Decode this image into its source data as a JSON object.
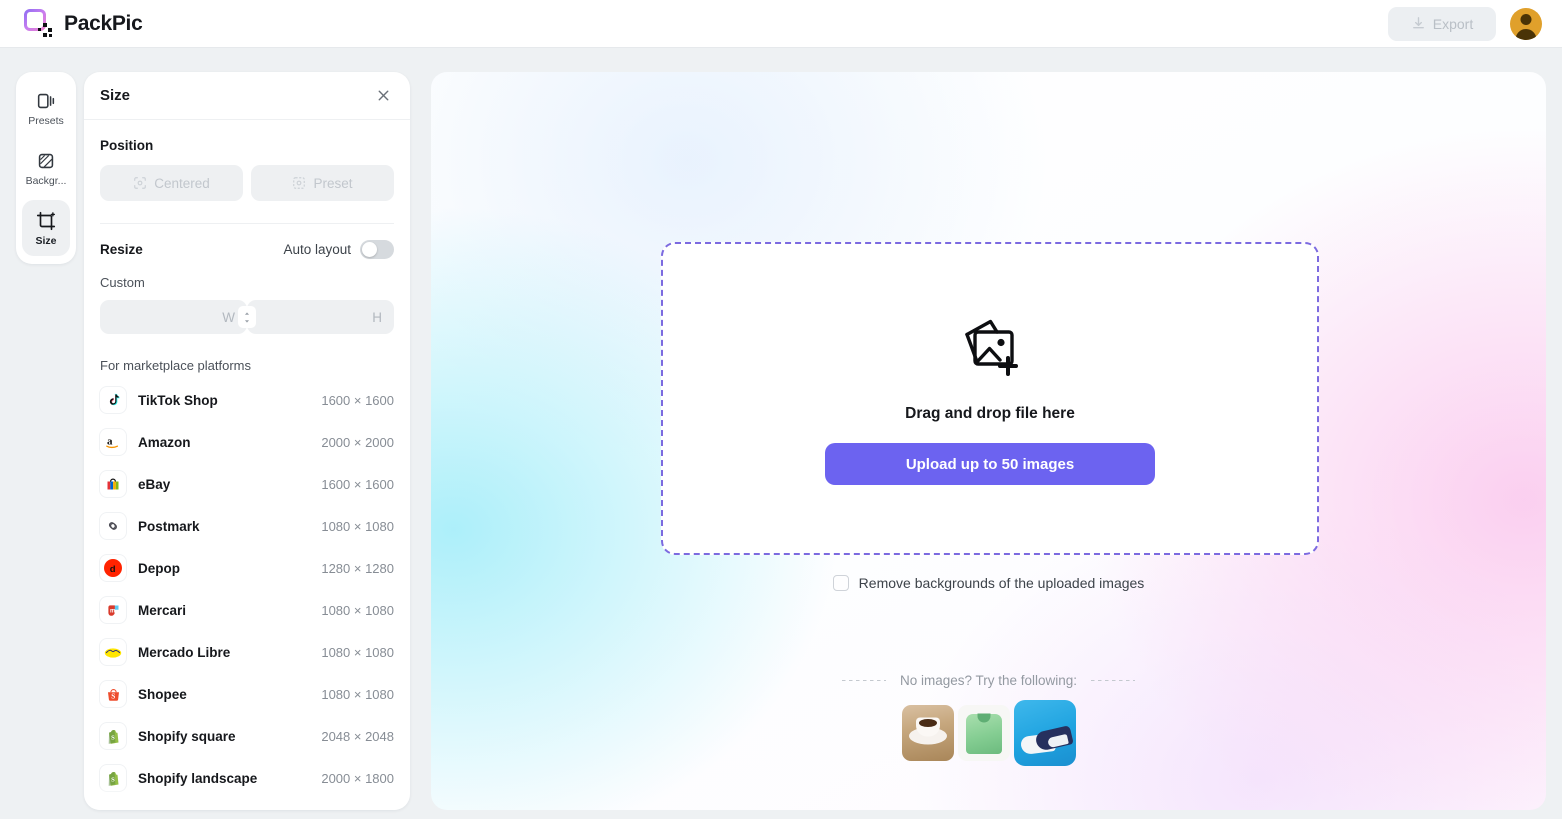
{
  "app": {
    "brand": "PackPic",
    "logo_gradient_from": "#8b6cf3",
    "logo_gradient_to": "#ef7ec8"
  },
  "topbar": {
    "export_label": "Export",
    "export_icon": "download-icon",
    "avatar_icon": "user-avatar",
    "avatar_color": "#e0a02b"
  },
  "rail": {
    "items": [
      {
        "label": "Presets",
        "icon": "presets-icon",
        "active": false
      },
      {
        "label": "Backgr...",
        "icon": "background-icon",
        "active": false
      },
      {
        "label": "Size",
        "icon": "size-crop-icon",
        "active": true
      }
    ]
  },
  "panel": {
    "title": "Size",
    "close_icon": "close-icon",
    "position": {
      "heading": "Position",
      "buttons": [
        {
          "label": "Centered",
          "icon": "target-centered-icon",
          "disabled": true
        },
        {
          "label": "Preset",
          "icon": "target-preset-icon",
          "disabled": true
        }
      ]
    },
    "resize": {
      "heading": "Resize",
      "auto_layout_label": "Auto layout",
      "auto_layout_on": false,
      "custom_label": "Custom",
      "width_value": "",
      "width_placeholder": "W",
      "height_value": "",
      "height_placeholder": "H",
      "swap_icon": "swap-vertical-icon"
    },
    "marketplace": {
      "heading": "For marketplace platforms",
      "items": [
        {
          "name": "TikTok Shop",
          "dimensions": "1600 × 1600",
          "icon": "tiktok-icon"
        },
        {
          "name": "Amazon",
          "dimensions": "2000 × 2000",
          "icon": "amazon-icon"
        },
        {
          "name": "eBay",
          "dimensions": "1600 × 1600",
          "icon": "ebay-icon"
        },
        {
          "name": "Postmark",
          "dimensions": "1080 × 1080",
          "icon": "postmark-icon"
        },
        {
          "name": "Depop",
          "dimensions": "1280 × 1280",
          "icon": "depop-icon"
        },
        {
          "name": "Mercari",
          "dimensions": "1080 × 1080",
          "icon": "mercari-icon"
        },
        {
          "name": "Mercado Libre",
          "dimensions": "1080 × 1080",
          "icon": "mercadolibre-icon"
        },
        {
          "name": "Shopee",
          "dimensions": "1080 × 1080",
          "icon": "shopee-icon"
        },
        {
          "name": "Shopify square",
          "dimensions": "2048 × 2048",
          "icon": "shopify-icon"
        },
        {
          "name": "Shopify landscape",
          "dimensions": "2000 × 1800",
          "icon": "shopify-icon"
        }
      ]
    }
  },
  "canvas": {
    "dropzone": {
      "icon": "add-images-icon",
      "title": "Drag and drop file here",
      "button_label": "Upload up to 50 images",
      "button_color": "#6c63f0",
      "border_color": "#7c6ae0"
    },
    "remove_bg": {
      "label": "Remove backgrounds of the uploaded images",
      "checked": false
    },
    "samples": {
      "label": "No images? Try the following:",
      "thumbs": [
        {
          "alt": "coffee cup on wooden table",
          "selected": false
        },
        {
          "alt": "green shirt on white background",
          "selected": false
        },
        {
          "alt": "sneakers on blue background",
          "selected": true
        }
      ]
    }
  }
}
